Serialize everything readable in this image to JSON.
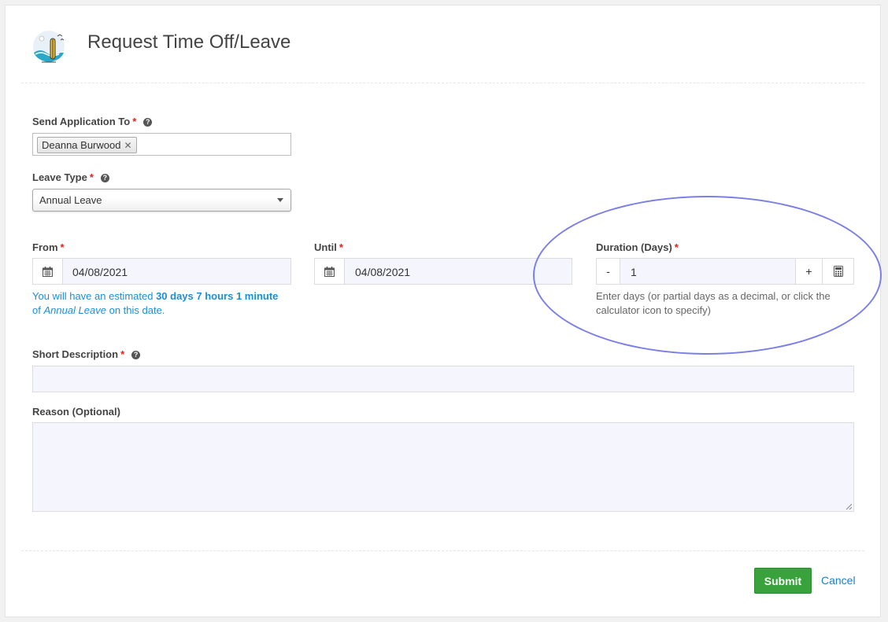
{
  "header": {
    "title": "Request Time Off/Leave",
    "logo_icon": "beach-surfboard-icon"
  },
  "form": {
    "send_to": {
      "label": "Send Application To",
      "required_mark": "*",
      "tag": "Deanna Burwood",
      "remove_glyph": "✕"
    },
    "leave_type": {
      "label": "Leave Type",
      "required_mark": "*",
      "value": "Annual Leave"
    },
    "from": {
      "label": "From",
      "required_mark": "*",
      "value": "04/08/2021"
    },
    "until": {
      "label": "Until",
      "required_mark": "*",
      "value": "04/08/2021"
    },
    "duration": {
      "label": "Duration (Days)",
      "required_mark": "*",
      "minus": "-",
      "value": "1",
      "plus": "+",
      "hint_line1": "Enter days (or partial days as a decimal, or click the",
      "hint_line2": "calculator icon to specify)"
    },
    "balance": {
      "prefix": "You will have an estimated ",
      "amount": "30 days 7 hours 1 minute",
      "of": "of ",
      "leave_name": "Annual Leave",
      "suffix": " on this date."
    },
    "short_description": {
      "label": "Short Description",
      "required_mark": "*",
      "value": ""
    },
    "reason": {
      "label": "Reason (Optional)",
      "value": ""
    }
  },
  "actions": {
    "submit": "Submit",
    "cancel": "Cancel"
  },
  "colors": {
    "accent_link": "#1a8fd8",
    "submit_green": "#3aa23d",
    "required_red": "#e02020",
    "annotation_ellipse": "#7b7fe6"
  }
}
